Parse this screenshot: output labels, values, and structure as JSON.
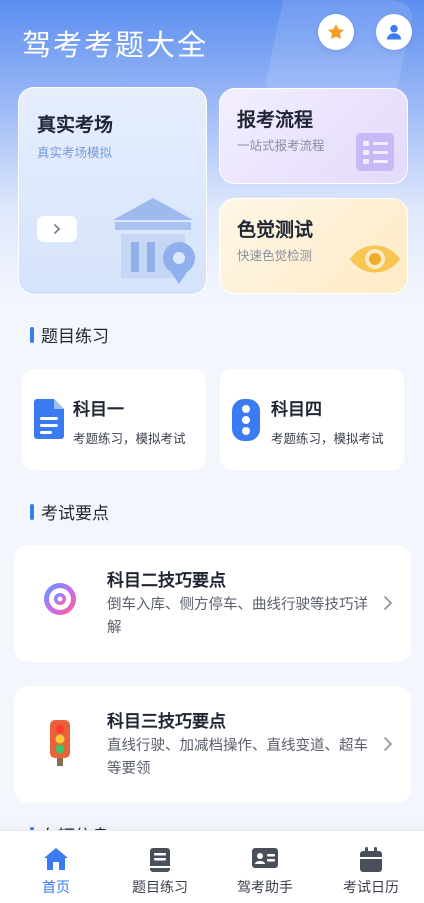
{
  "header": {
    "title": "驾考考题大全",
    "icons": [
      "star-icon",
      "user-icon"
    ]
  },
  "feature_cards": {
    "exam": {
      "title": "真实考场",
      "subtitle": "真实考场模拟",
      "icon": "exam-building-icon"
    },
    "process": {
      "title": "报考流程",
      "subtitle": "一站式报考流程",
      "icon": "checklist-icon"
    },
    "color": {
      "title": "色觉测试",
      "subtitle": "快速色觉检测",
      "icon": "eye-icon"
    }
  },
  "practice": {
    "section_title": "题目练习",
    "subjects": [
      {
        "name": "科目一",
        "desc": "考题练习，模拟考试",
        "icon": "document-icon"
      },
      {
        "name": "科目四",
        "desc": "考题练习，模拟考试",
        "icon": "traffic-light-icon"
      }
    ]
  },
  "key_points": {
    "section_title": "考试要点",
    "items": [
      {
        "title": "科目二技巧要点",
        "desc": "倒车入库、侧方停车、曲线行驶等技巧详解",
        "icon": "steering-wheel-icon"
      },
      {
        "title": "科目三技巧要点",
        "desc": "直线行驶、加减档操作、直线变道、超车等要领",
        "icon": "traffic-light-icon"
      }
    ]
  },
  "next_section_title": "车辆信息",
  "tabbar": {
    "tabs": [
      {
        "label": "首页",
        "icon": "home-icon",
        "active": true
      },
      {
        "label": "题目练习",
        "icon": "book-icon",
        "active": false
      },
      {
        "label": "驾考助手",
        "icon": "id-card-icon",
        "active": false
      },
      {
        "label": "考试日历",
        "icon": "calendar-icon",
        "active": false
      }
    ]
  },
  "colors": {
    "accent": "#3b7bf1",
    "star": "#f59a23"
  }
}
